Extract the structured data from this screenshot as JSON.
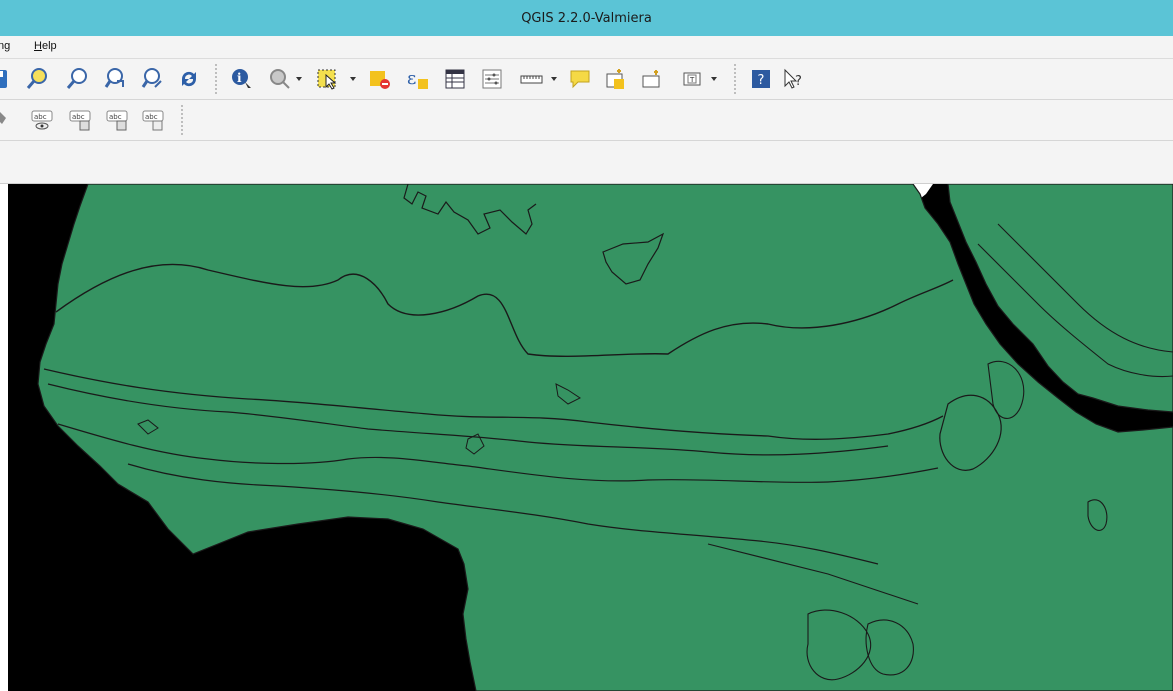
{
  "window": {
    "title": "QGIS 2.2.0-Valmiera"
  },
  "menubar": {
    "items": [
      {
        "label_prefix": "",
        "label_underlined": "",
        "label_rest": "ng"
      },
      {
        "label_prefix": "",
        "label_underlined": "H",
        "label_rest": "elp"
      }
    ]
  },
  "toolbar": {
    "icons": [
      "save-icon",
      "zoom-to-layer-icon",
      "zoom-last-icon",
      "zoom-next-icon",
      "zoom-selection-icon",
      "refresh-icon",
      "identify-icon",
      "map-tips-icon",
      "select-features-icon",
      "deselect-icon",
      "expression-select-icon",
      "attribute-table-icon",
      "statistics-icon",
      "measure-icon",
      "annotation-icon",
      "new-bookmark-icon",
      "show-bookmarks-icon",
      "text-annotation-icon",
      "help-icon",
      "whats-this-icon"
    ]
  },
  "labels_toolbar": {
    "icons": [
      "pin-labels-icon",
      "show-hide-labels-icon",
      "move-label-icon",
      "rotate-label-icon",
      "change-label-icon"
    ],
    "abc_text": "abc"
  },
  "map": {
    "land_color": "#369362",
    "water_color": "#000000",
    "outline_color": "#1a1a1a",
    "nodata_color": "#ffffff"
  }
}
